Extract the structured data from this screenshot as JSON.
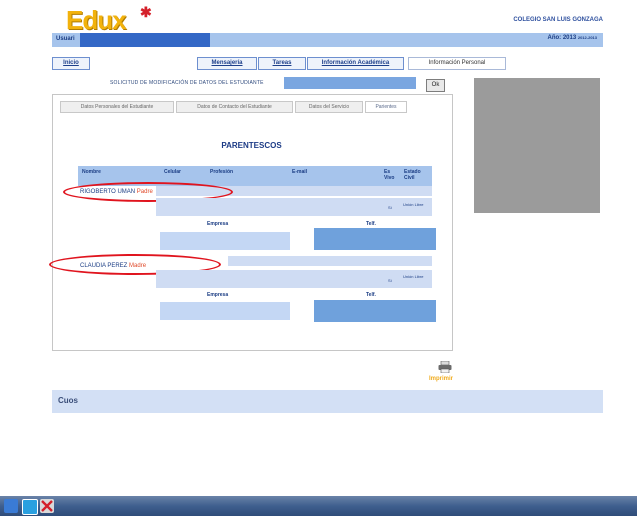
{
  "header": {
    "logo_text": "Edux",
    "school_name": "COLEGIO SAN LUIS GONZAGA",
    "user_label": "Usuari",
    "year_label": "Año: 2013",
    "year_value": "2012-2013"
  },
  "nav": {
    "items": [
      {
        "label": "Inicio"
      },
      {
        "label": "Mensajería"
      },
      {
        "label": "Tareas"
      },
      {
        "label": "Información Académica"
      },
      {
        "label": "Información Personal"
      }
    ]
  },
  "request": {
    "label": "SOLICITUD DE MODIFICACIÓN DE DATOS DEL ESTUDIANTE",
    "ok_label": "Ok"
  },
  "subtabs": [
    {
      "label": "Datos Personales del Estudiante"
    },
    {
      "label": "Datos de Contacto del Estudiante"
    },
    {
      "label": "Datos del Servicio"
    },
    {
      "label": "Parientes"
    }
  ],
  "section": {
    "title": "PARENTESCOS"
  },
  "table": {
    "headers": {
      "nombre": "Nombre",
      "celular": "Celular",
      "profesion": "Profesión",
      "email": "E-mail",
      "vive": "Es Vivo",
      "estado": "Estado Civil"
    },
    "rows": [
      {
        "name": "RIGOBERTO UMAN",
        "relation": "Padre",
        "vive_value": "Sí",
        "estado_value": "Unión Libre",
        "empresa_label": "Empresa",
        "telefono_label": "Telf."
      },
      {
        "name": "CLAUDIA PEREZ",
        "relation": "Madre",
        "vive_value": "Sí",
        "estado_value": "Unión Libre",
        "empresa_label": "Empresa",
        "telefono_label": "Telf."
      }
    ]
  },
  "print": {
    "label": "Imprimir"
  },
  "footer": {
    "logo_text": "Cuos"
  },
  "colors": {
    "header_blue": "#a6c4ec",
    "field_blue": "#c4d7f4",
    "dark_field_blue": "#6fa1dc",
    "highlight_red": "#e0141e",
    "logo_gold": "#f2b20c"
  }
}
